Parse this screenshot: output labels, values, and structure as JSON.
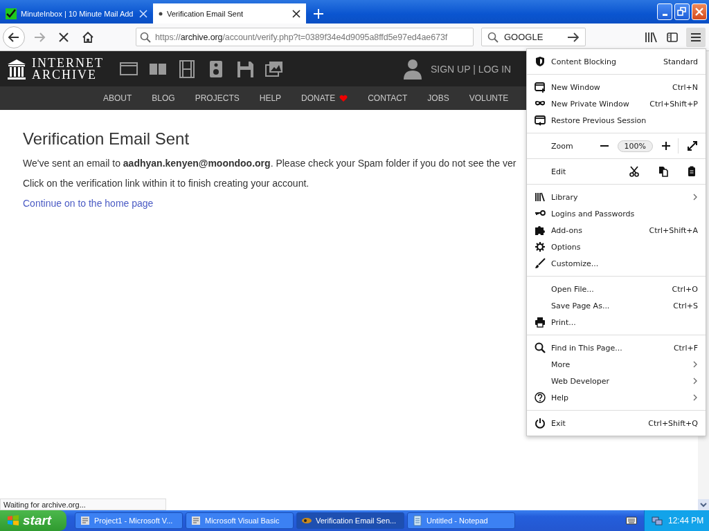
{
  "tabs": [
    {
      "label": "MinuteInbox | 10 Minute Mail Add",
      "selected": false,
      "loading": false
    },
    {
      "label": "Verification Email Sent",
      "selected": true,
      "loading": true
    }
  ],
  "address_bar": {
    "scheme": "https://",
    "host": "archive.org",
    "path": "/account/verify.php?t=0389f34e4d9095a8ffd5e97ed4ae673f"
  },
  "search_field": {
    "value": "GOOGLE"
  },
  "site_header": {
    "logo_lines": [
      "INTERNET",
      "ARCHIVE"
    ],
    "account_link": "SIGN UP | LOG IN"
  },
  "site_nav": [
    {
      "label": "ABOUT",
      "kind": "plain"
    },
    {
      "label": "BLOG",
      "kind": "plain"
    },
    {
      "label": "PROJECTS",
      "kind": "plain"
    },
    {
      "label": "HELP",
      "kind": "plain"
    },
    {
      "label": "DONATE",
      "kind": "heart"
    },
    {
      "label": "CONTACT",
      "kind": "plain"
    },
    {
      "label": "JOBS",
      "kind": "plain"
    },
    {
      "label": "VOLUNTE",
      "kind": "plain"
    }
  ],
  "page": {
    "heading": "Verification Email Sent",
    "paragraphs": [
      "We've sent an email to **aadhyan.kenyen@moondoo.org**. Please check your Spam folder if you do not see the ver",
      "Click on the verification link within it to finish creating your account."
    ],
    "link": "Continue on to the home page"
  },
  "app_menu": {
    "sections": [
      {
        "items": [
          {
            "kind": "item",
            "label": "Content Blocking",
            "shortcut": "Standard"
          }
        ]
      },
      {
        "items": [
          {
            "kind": "item",
            "label": "New Window",
            "shortcut": "Ctrl+N"
          },
          {
            "kind": "item",
            "label": "New Private Window",
            "shortcut": "Ctrl+Shift+P"
          },
          {
            "kind": "item",
            "label": "Restore Previous Session"
          }
        ]
      },
      {
        "items": [
          {
            "kind": "zoom",
            "label": "Zoom",
            "value": "100%"
          }
        ]
      },
      {
        "items": [
          {
            "kind": "edit",
            "label": "Edit"
          }
        ]
      },
      {
        "items": [
          {
            "kind": "submenu",
            "label": "Library"
          },
          {
            "kind": "item",
            "label": "Logins and Passwords"
          },
          {
            "kind": "item",
            "label": "Add-ons",
            "shortcut": "Ctrl+Shift+A"
          },
          {
            "kind": "item",
            "label": "Options"
          },
          {
            "kind": "item",
            "label": "Customize..."
          }
        ]
      },
      {
        "items": [
          {
            "kind": "item",
            "label": "Open File...",
            "shortcut": "Ctrl+O"
          },
          {
            "kind": "item",
            "label": "Save Page As...",
            "shortcut": "Ctrl+S"
          },
          {
            "kind": "item",
            "label": "Print..."
          }
        ]
      },
      {
        "items": [
          {
            "kind": "item",
            "label": "Find in This Page...",
            "shortcut": "Ctrl+F"
          },
          {
            "kind": "submenu",
            "label": "More"
          },
          {
            "kind": "submenu",
            "label": "Web Developer"
          },
          {
            "kind": "submenu",
            "label": "Help"
          }
        ]
      },
      {
        "items": [
          {
            "kind": "item",
            "label": "Exit",
            "shortcut": "Ctrl+Shift+Q"
          }
        ]
      }
    ]
  },
  "status_bar": "Waiting for archive.org...",
  "taskbar": {
    "start": "start",
    "tasks": [
      {
        "label": "Project1 - Microsoft V...",
        "selected": false
      },
      {
        "label": "Microsoft Visual Basic",
        "selected": false
      },
      {
        "label": "Verification Email Sen...",
        "selected": true
      },
      {
        "label": "Untitled - Notepad",
        "selected": false
      }
    ],
    "clock": "12:44 PM"
  }
}
